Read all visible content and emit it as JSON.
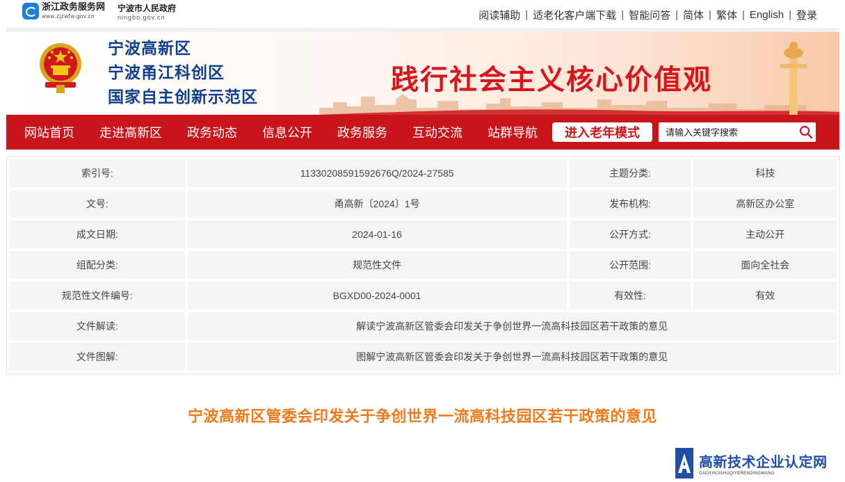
{
  "topbar": {
    "zj_name": "浙江政务服务网",
    "zj_url": "www.zjzwfw.gov.cn",
    "nb_name": "宁波市人民政府",
    "nb_url": "ningbo.gov.cn",
    "links": [
      "阅读辅助",
      "适老化客户端下载",
      "智能问答",
      "简体",
      "繁体",
      "English",
      "登录"
    ]
  },
  "banner": {
    "names": [
      "宁波高新区",
      "宁波甬江科创区",
      "国家自主创新示范区"
    ],
    "slogan": "践行社会主义核心价值观"
  },
  "nav": {
    "items": [
      "网站首页",
      "走进高新区",
      "政务动态",
      "信息公开",
      "政务服务",
      "互动交流",
      "站群导航"
    ],
    "elder_mode": "进入老年模式",
    "search_placeholder": "请输入关键字搜索"
  },
  "info": {
    "index_label": "索引号:",
    "index_value": "11330208591592676Q/2024-27585",
    "topic_label": "主题分类:",
    "topic_value": "科技",
    "docno_label": "文号:",
    "docno_value": "甬高新〔2024〕1号",
    "publisher_label": "发布机构:",
    "publisher_value": "高新区办公室",
    "date_label": "成文日期:",
    "date_value": "2024-01-16",
    "method_label": "公开方式:",
    "method_value": "主动公开",
    "group_label": "组配分类:",
    "group_value": "规范性文件",
    "scope_label": "公开范围:",
    "scope_value": "面向全社会",
    "regno_label": "规范性文件编号:",
    "regno_value": "BGXD00-2024-0001",
    "validity_label": "有效性:",
    "validity_value": "有效",
    "interpret_label": "文件解读:",
    "interpret_value": "解读宁波高新区管委会印发关于争创世界一流高科技园区若干政策的意见",
    "graphic_label": "文件图解:",
    "graphic_value": "图解宁波高新区管委会印发关于争创世界一流高科技园区若干政策的意见"
  },
  "doc": {
    "title": "宁波高新区管委会印发关于争创世界一流高科技园区若干政策的意见"
  },
  "watermark": {
    "name": "高新技术企业认定网",
    "pinyin": "GAOXINJISHUQIYERENDINGWANG"
  },
  "colors": {
    "nav_red": "#c8141b",
    "site_blue": "#0f3f8c",
    "title_orange": "#f07a1a",
    "slogan_red": "#d8141c"
  }
}
